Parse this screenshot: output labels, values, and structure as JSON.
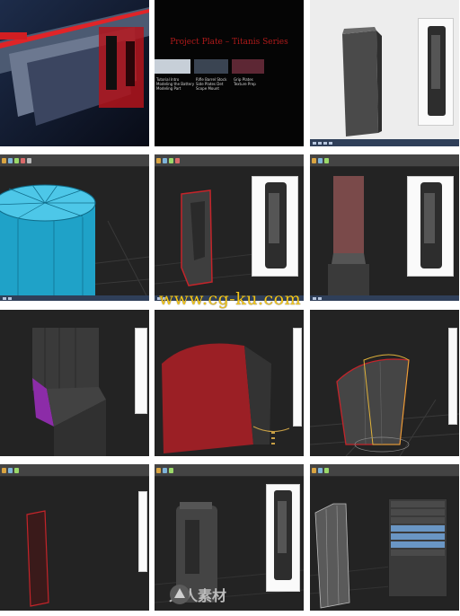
{
  "watermark_text": "www.cg-ku.com",
  "site_logo_text": "人人素材",
  "slide": {
    "title": "Project Plate – Titanis Series",
    "col1": [
      "Tutorial Intro",
      "Modeling the Battery",
      "Modeling Part"
    ],
    "col2": [
      "Rifle Barrel Stock",
      "Side Plates Det",
      "Scope Mount"
    ],
    "col3": [
      "Grip Plates",
      "Texture Prep"
    ]
  },
  "colors": {
    "selection": "#c4242a",
    "viewport": "#232323",
    "cyan_mesh": "#1fa2c8",
    "watermark": "#f2c51a"
  }
}
